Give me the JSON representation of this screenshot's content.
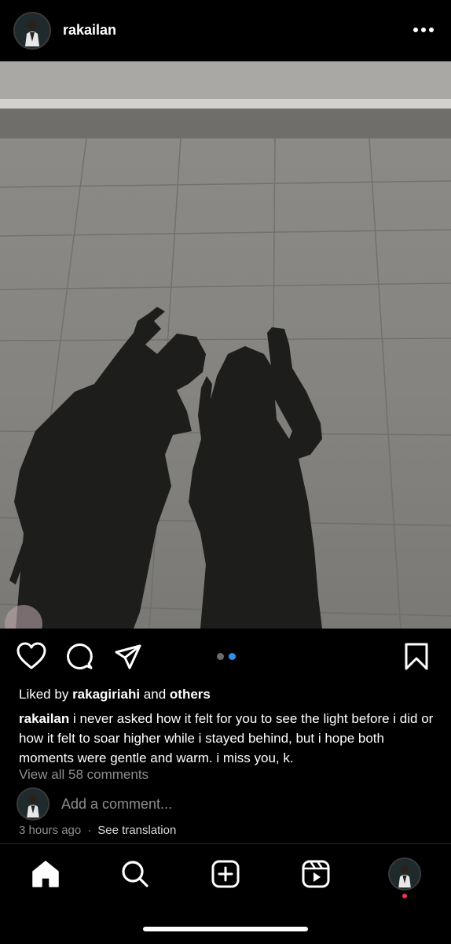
{
  "post": {
    "username": "rakailan",
    "liked_by_prefix": "Liked by",
    "liked_by_user": "rakagiriahi",
    "liked_by_and": "and",
    "liked_by_others": "others",
    "caption_user": "rakailan",
    "caption_text": "i never asked how it felt for you to see the light before i did or how it felt to soar higher while i stayed behind, but i hope both moments were gentle and warm. i miss you, k.",
    "view_comments": "View all 58 comments",
    "add_comment_placeholder": "Add a comment...",
    "time_ago": "3 hours ago",
    "separator": "·",
    "see_translation": "See translation",
    "carousel": {
      "count": 2,
      "active_index": 1
    }
  },
  "icons": {
    "header": [
      "avatar",
      "more-icon"
    ],
    "actions": [
      "heart-icon",
      "comment-icon",
      "share-icon",
      "bookmark-icon"
    ],
    "nav": [
      "home-icon",
      "search-icon",
      "create-icon",
      "reels-icon",
      "profile-avatar"
    ]
  },
  "colors": {
    "background": "#000000",
    "muted_text": "#8e8e8e",
    "carousel_active": "#2f8fe8",
    "notification_dot": "#ff2d55"
  }
}
